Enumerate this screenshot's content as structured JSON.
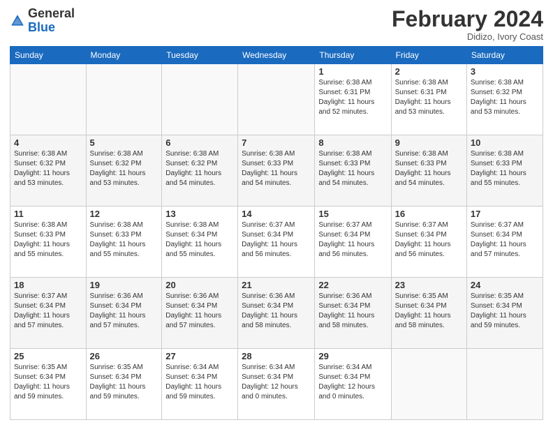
{
  "header": {
    "logo_general": "General",
    "logo_blue": "Blue",
    "month_title": "February 2024",
    "location": "Didizo, Ivory Coast"
  },
  "days_of_week": [
    "Sunday",
    "Monday",
    "Tuesday",
    "Wednesday",
    "Thursday",
    "Friday",
    "Saturday"
  ],
  "weeks": [
    [
      {
        "num": "",
        "info": ""
      },
      {
        "num": "",
        "info": ""
      },
      {
        "num": "",
        "info": ""
      },
      {
        "num": "",
        "info": ""
      },
      {
        "num": "1",
        "info": "Sunrise: 6:38 AM\nSunset: 6:31 PM\nDaylight: 11 hours\nand 52 minutes."
      },
      {
        "num": "2",
        "info": "Sunrise: 6:38 AM\nSunset: 6:31 PM\nDaylight: 11 hours\nand 53 minutes."
      },
      {
        "num": "3",
        "info": "Sunrise: 6:38 AM\nSunset: 6:32 PM\nDaylight: 11 hours\nand 53 minutes."
      }
    ],
    [
      {
        "num": "4",
        "info": "Sunrise: 6:38 AM\nSunset: 6:32 PM\nDaylight: 11 hours\nand 53 minutes."
      },
      {
        "num": "5",
        "info": "Sunrise: 6:38 AM\nSunset: 6:32 PM\nDaylight: 11 hours\nand 53 minutes."
      },
      {
        "num": "6",
        "info": "Sunrise: 6:38 AM\nSunset: 6:32 PM\nDaylight: 11 hours\nand 54 minutes."
      },
      {
        "num": "7",
        "info": "Sunrise: 6:38 AM\nSunset: 6:33 PM\nDaylight: 11 hours\nand 54 minutes."
      },
      {
        "num": "8",
        "info": "Sunrise: 6:38 AM\nSunset: 6:33 PM\nDaylight: 11 hours\nand 54 minutes."
      },
      {
        "num": "9",
        "info": "Sunrise: 6:38 AM\nSunset: 6:33 PM\nDaylight: 11 hours\nand 54 minutes."
      },
      {
        "num": "10",
        "info": "Sunrise: 6:38 AM\nSunset: 6:33 PM\nDaylight: 11 hours\nand 55 minutes."
      }
    ],
    [
      {
        "num": "11",
        "info": "Sunrise: 6:38 AM\nSunset: 6:33 PM\nDaylight: 11 hours\nand 55 minutes."
      },
      {
        "num": "12",
        "info": "Sunrise: 6:38 AM\nSunset: 6:33 PM\nDaylight: 11 hours\nand 55 minutes."
      },
      {
        "num": "13",
        "info": "Sunrise: 6:38 AM\nSunset: 6:34 PM\nDaylight: 11 hours\nand 55 minutes."
      },
      {
        "num": "14",
        "info": "Sunrise: 6:37 AM\nSunset: 6:34 PM\nDaylight: 11 hours\nand 56 minutes."
      },
      {
        "num": "15",
        "info": "Sunrise: 6:37 AM\nSunset: 6:34 PM\nDaylight: 11 hours\nand 56 minutes."
      },
      {
        "num": "16",
        "info": "Sunrise: 6:37 AM\nSunset: 6:34 PM\nDaylight: 11 hours\nand 56 minutes."
      },
      {
        "num": "17",
        "info": "Sunrise: 6:37 AM\nSunset: 6:34 PM\nDaylight: 11 hours\nand 57 minutes."
      }
    ],
    [
      {
        "num": "18",
        "info": "Sunrise: 6:37 AM\nSunset: 6:34 PM\nDaylight: 11 hours\nand 57 minutes."
      },
      {
        "num": "19",
        "info": "Sunrise: 6:36 AM\nSunset: 6:34 PM\nDaylight: 11 hours\nand 57 minutes."
      },
      {
        "num": "20",
        "info": "Sunrise: 6:36 AM\nSunset: 6:34 PM\nDaylight: 11 hours\nand 57 minutes."
      },
      {
        "num": "21",
        "info": "Sunrise: 6:36 AM\nSunset: 6:34 PM\nDaylight: 11 hours\nand 58 minutes."
      },
      {
        "num": "22",
        "info": "Sunrise: 6:36 AM\nSunset: 6:34 PM\nDaylight: 11 hours\nand 58 minutes."
      },
      {
        "num": "23",
        "info": "Sunrise: 6:35 AM\nSunset: 6:34 PM\nDaylight: 11 hours\nand 58 minutes."
      },
      {
        "num": "24",
        "info": "Sunrise: 6:35 AM\nSunset: 6:34 PM\nDaylight: 11 hours\nand 59 minutes."
      }
    ],
    [
      {
        "num": "25",
        "info": "Sunrise: 6:35 AM\nSunset: 6:34 PM\nDaylight: 11 hours\nand 59 minutes."
      },
      {
        "num": "26",
        "info": "Sunrise: 6:35 AM\nSunset: 6:34 PM\nDaylight: 11 hours\nand 59 minutes."
      },
      {
        "num": "27",
        "info": "Sunrise: 6:34 AM\nSunset: 6:34 PM\nDaylight: 11 hours\nand 59 minutes."
      },
      {
        "num": "28",
        "info": "Sunrise: 6:34 AM\nSunset: 6:34 PM\nDaylight: 12 hours\nand 0 minutes."
      },
      {
        "num": "29",
        "info": "Sunrise: 6:34 AM\nSunset: 6:34 PM\nDaylight: 12 hours\nand 0 minutes."
      },
      {
        "num": "",
        "info": ""
      },
      {
        "num": "",
        "info": ""
      }
    ]
  ]
}
